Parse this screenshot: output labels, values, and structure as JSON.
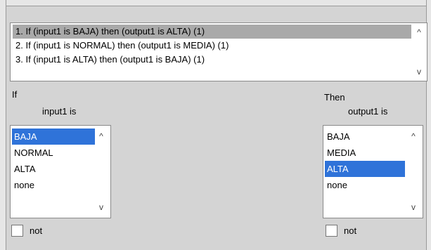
{
  "rules": [
    {
      "text": "1. If (input1 is BAJA) then (output1 is ALTA) (1)",
      "selected": true
    },
    {
      "text": "2. If (input1 is NORMAL) then (output1 is MEDIA) (1)",
      "selected": false
    },
    {
      "text": "3. If (input1 is ALTA) then (output1 is BAJA) (1)",
      "selected": false
    }
  ],
  "antecedent": {
    "if_label": "If",
    "var_label": "input1 is",
    "items": [
      "BAJA",
      "NORMAL",
      "ALTA",
      "none"
    ],
    "selected_index": 0,
    "not_label": "not",
    "not_checked": false
  },
  "consequent": {
    "then_label": "Then",
    "var_label": "output1 is",
    "items": [
      "BAJA",
      "MEDIA",
      "ALTA",
      "none"
    ],
    "selected_index": 2,
    "not_label": "not",
    "not_checked": false
  },
  "icons": {
    "scroll_up": "^",
    "scroll_down": "v"
  },
  "colors": {
    "selection_blue": "#2f73d9",
    "rule_selected_gray": "#a9a9a9",
    "panel_bg": "#d4d4d4"
  }
}
